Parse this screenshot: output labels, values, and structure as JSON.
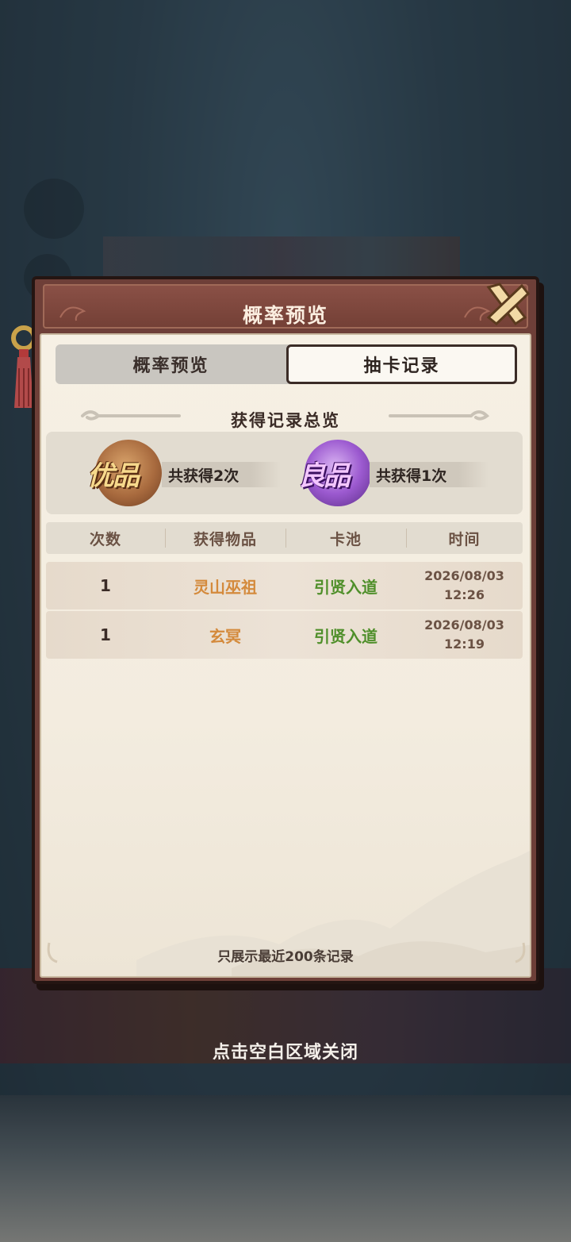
{
  "dialog": {
    "title": "概率预览",
    "close_icon": "close-x-icon"
  },
  "tabs": [
    {
      "label": "概率预览",
      "active": false
    },
    {
      "label": "抽卡记录",
      "active": true
    }
  ],
  "summary": {
    "title": "获得记录总览",
    "items": [
      {
        "badge_text": "优品",
        "count_text": "共获得2次",
        "color": "#c08a4a"
      },
      {
        "badge_text": "良品",
        "count_text": "共获得1次",
        "color": "#9c5ad0"
      }
    ]
  },
  "table": {
    "headers": [
      "次数",
      "获得物品",
      "卡池",
      "时间"
    ],
    "rows": [
      {
        "count": "1",
        "item": "灵山巫祖",
        "pool": "引贤入道",
        "date": "2026/08/03",
        "time": "12:26"
      },
      {
        "count": "1",
        "item": "玄冥",
        "pool": "引贤入道",
        "date": "2026/08/03",
        "time": "12:19"
      }
    ]
  },
  "footer_note": "只展示最近200条记录",
  "close_hint": "点击空白区域关闭"
}
